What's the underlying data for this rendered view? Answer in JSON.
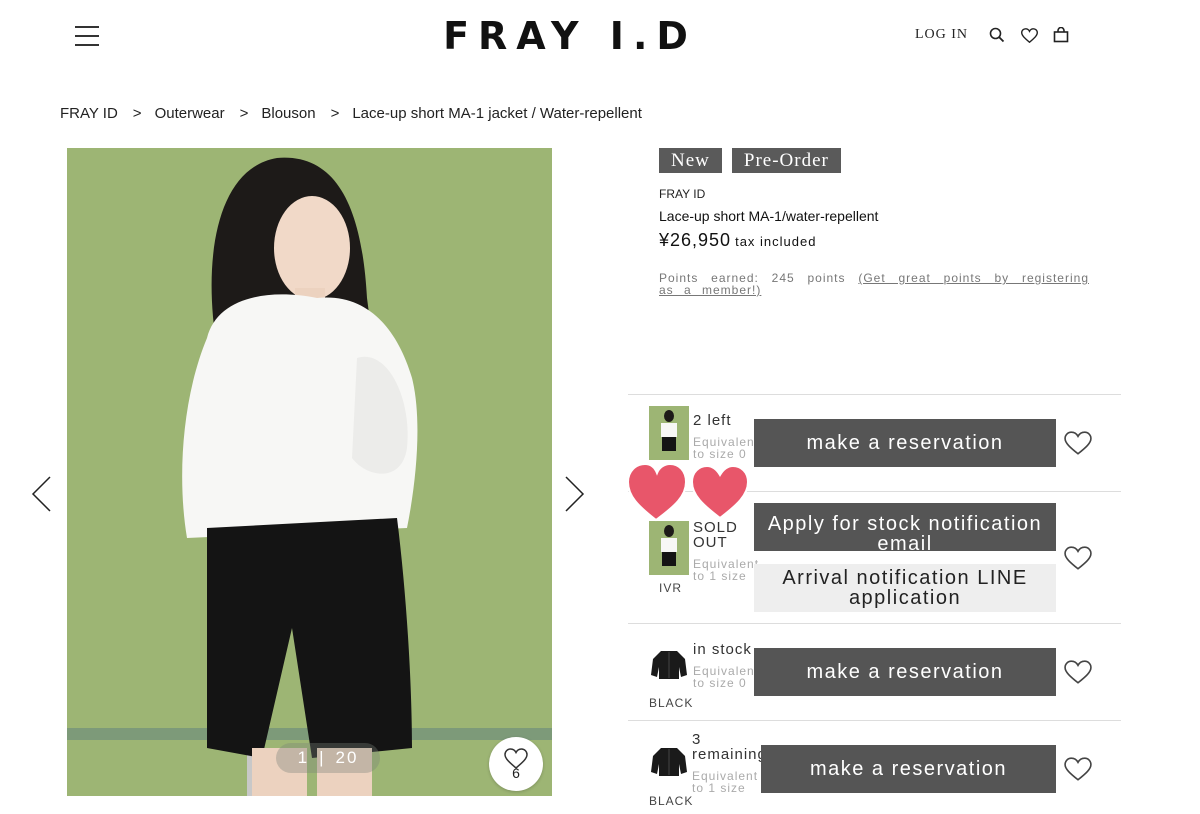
{
  "header": {
    "logo": "FRAY I.D",
    "login": "LOG IN",
    "icons": [
      "menu-icon",
      "search-icon",
      "heart-icon",
      "bag-icon"
    ]
  },
  "breadcrumb": {
    "items": [
      "FRAY ID",
      "Outerwear",
      "Blouson",
      "Lace-up short MA-1 jacket / Water-repellent"
    ],
    "separator": ">"
  },
  "gallery": {
    "current": "1",
    "separator": "|",
    "total": "20",
    "favorite_count": "6",
    "background": "#9db574"
  },
  "product": {
    "tags": [
      "New",
      "Pre-Order"
    ],
    "brand": "FRAY ID",
    "name": "Lace-up short MA-1/water-repellent",
    "price": "¥26,950",
    "tax": "tax included",
    "points_text": "Points earned: 245 points",
    "points_link": "(Get great points by registering as a member!)"
  },
  "variants": [
    {
      "stock": "2 left",
      "size": "Equivalent to size 0",
      "color": "",
      "buttons": [
        "make a reservation"
      ]
    },
    {
      "stock": "SOLD OUT",
      "size": "Equivalent to 1 size",
      "color": "IVR",
      "buttons": [
        "Apply for stock notification email",
        "Arrival notification LINE application"
      ]
    },
    {
      "stock": "in stock",
      "size": "Equivalent to size 0",
      "color": "BLACK",
      "buttons": [
        "make a reservation"
      ]
    },
    {
      "stock": "3 remaining",
      "size": "Equivalent to 1 size",
      "color": "BLACK",
      "buttons": [
        "make a reservation"
      ]
    }
  ],
  "colors": {
    "button_dark": "#555555",
    "button_light": "#eeeeee",
    "tag": "#5a5a5a",
    "sticker_heart": "#e8566a"
  }
}
